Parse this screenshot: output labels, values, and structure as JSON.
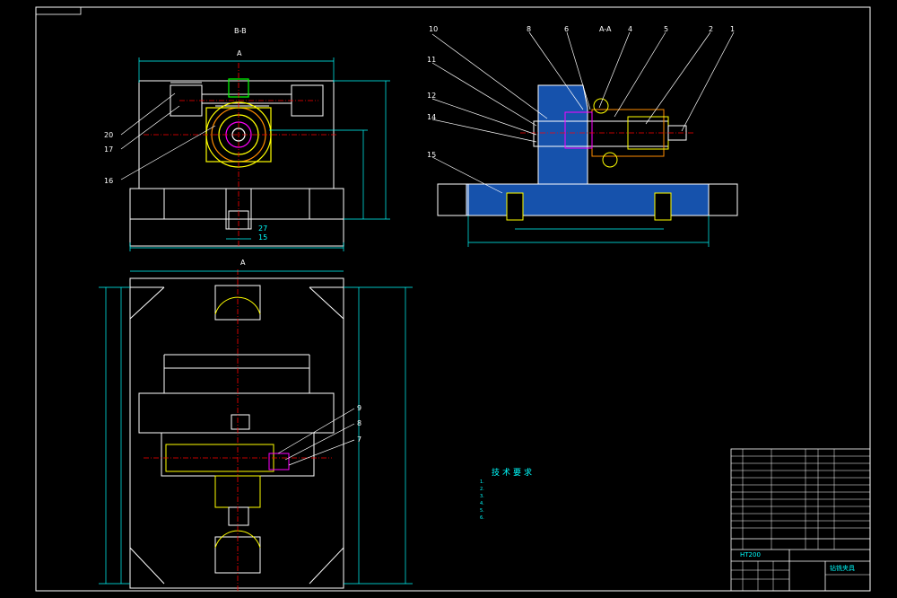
{
  "sheet": {
    "colors": {
      "outline": "#ffffff",
      "dimension": "#00ffff",
      "center": "#ff0000",
      "part": "#ffff00",
      "hatch": "#1e6ee6",
      "accent": "#ff00ff",
      "table": "#00ff00"
    }
  },
  "views": {
    "front_label": "B-B",
    "side_label": "A-A",
    "plan_label_top": "A",
    "plan_label_mid": "A"
  },
  "callouts": {
    "front": [
      "20",
      "17",
      "16"
    ],
    "side_top": [
      "10",
      "8",
      "6",
      "A-A",
      "4",
      "5",
      "2",
      "1"
    ],
    "side_left": [
      "11",
      "12",
      "14",
      "15"
    ],
    "plan": [
      "9",
      "8",
      "7"
    ]
  },
  "dimensions": {
    "front_bottom_1": "27",
    "front_bottom_2": "15"
  },
  "tech_requirements": {
    "title": "技术要求",
    "lines": [
      "1.",
      "2.",
      "3.",
      "4.",
      "5.",
      "6."
    ]
  },
  "title_block": {
    "name": "钻铣夹具",
    "material": "HT200"
  }
}
